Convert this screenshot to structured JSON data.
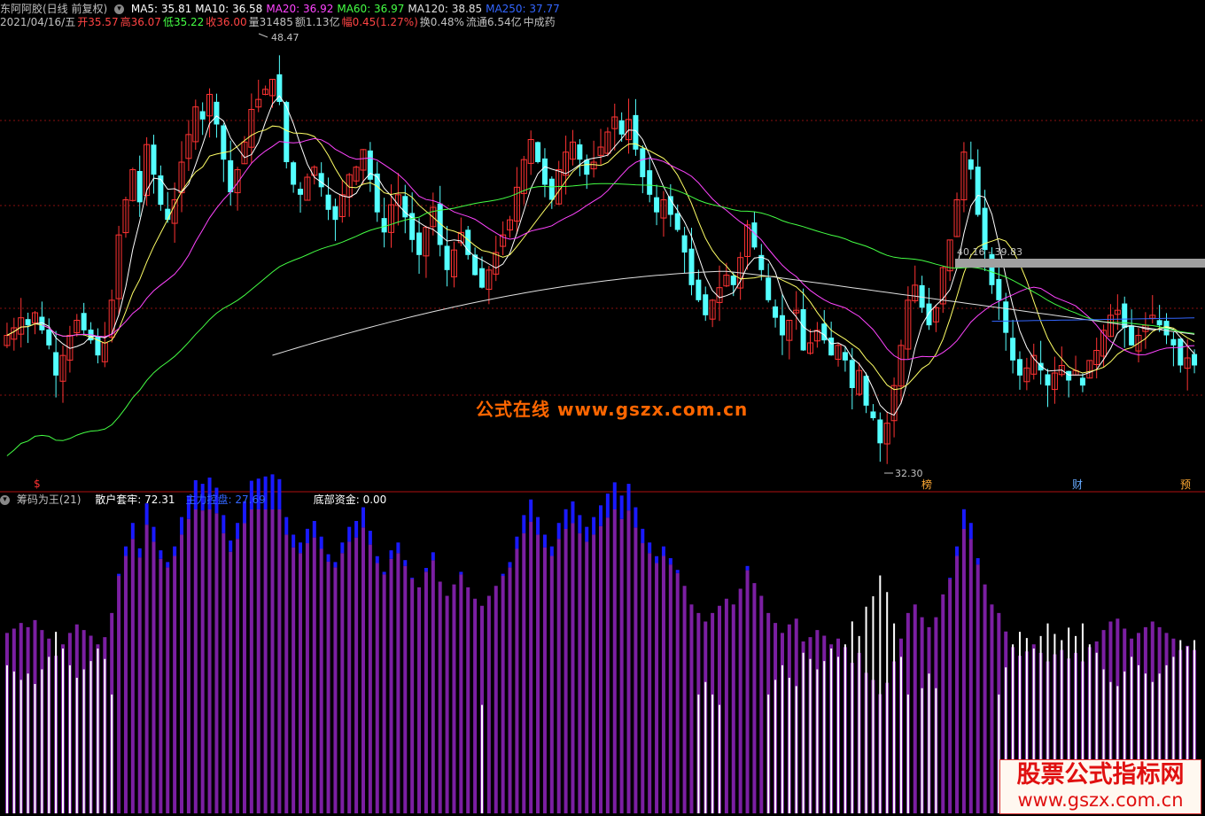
{
  "header": {
    "stock_name": "东阿阿胶(日线 前复权)",
    "ma": [
      {
        "label": "MA5: 35.81",
        "color": "#ffffff"
      },
      {
        "label": "MA10: 36.58",
        "color": "#ffffff"
      },
      {
        "label": "MA20: 36.92",
        "color": "#ff44ff"
      },
      {
        "label": "MA60: 36.97",
        "color": "#44ff44"
      },
      {
        "label": "MA120: 38.85",
        "color": "#e0e0e0"
      },
      {
        "label": "MA250: 37.77",
        "color": "#3366ff"
      }
    ],
    "info": [
      {
        "label": "2021/04/16/五",
        "color": "#c0c0c0"
      },
      {
        "label": "开35.57",
        "color": "#ff4444"
      },
      {
        "label": "高36.07",
        "color": "#ff4444"
      },
      {
        "label": "低35.22",
        "color": "#44ff44"
      },
      {
        "label": "收36.00",
        "color": "#ff4444"
      },
      {
        "label": "量31485",
        "color": "#c0c0c0"
      },
      {
        "label": "额1.13亿",
        "color": "#c0c0c0"
      },
      {
        "label": "幅0.45(1.27%)",
        "color": "#ff4444"
      },
      {
        "label": "换0.48%",
        "color": "#c0c0c0"
      },
      {
        "label": "流通6.54亿",
        "color": "#c0c0c0"
      },
      {
        "label": "中成药",
        "color": "#c0c0c0"
      }
    ]
  },
  "indicator": {
    "name": "筹码为王(21)",
    "items": [
      {
        "label": "散户套牢: 72.31",
        "color": "#ffffff"
      },
      {
        "label": "主力控盘: 27.69",
        "color": "#3366ff"
      },
      {
        "label": "底部资金: 0.00",
        "color": "#ffffff"
      }
    ]
  },
  "price_labels": {
    "high": "48.47",
    "low": "32.30",
    "range": "40.16 - 39.83"
  },
  "markers": [
    {
      "text": "$",
      "color": "#ff3333"
    },
    {
      "text": "榜",
      "color": "#ffaa33"
    },
    {
      "text": "财",
      "color": "#66aaff"
    },
    {
      "text": "预",
      "color": "#ffaa33"
    }
  ],
  "watermark": {
    "center": "公式在线  www.gszx.com.cn",
    "corner_title": "股票公式指标网",
    "corner_url": "www.gszx.com.cn"
  },
  "colors": {
    "up": "#ff3333",
    "down": "#54ffff",
    "ma5": "#ffffff",
    "ma10": "#ffff66",
    "ma20": "#ff44ff",
    "ma60": "#44ff44",
    "ma120": "#e0e0e0",
    "ma250": "#3366ff"
  },
  "chart_data": {
    "type": "line",
    "title": "",
    "xlabel": "",
    "ylabel": "",
    "ylim": [
      31.5,
      49.5
    ],
    "close_series": [
      37.2,
      37.5,
      37.9,
      37.6,
      38.1,
      37.4,
      36.8,
      35.6,
      36.4,
      37.2,
      37.8,
      37.4,
      37.0,
      36.4,
      36.9,
      38.6,
      41.2,
      42.6,
      43.8,
      42.5,
      44.8,
      43.6,
      42.4,
      41.8,
      42.6,
      44.1,
      45.2,
      46.3,
      45.8,
      46.8,
      45.6,
      44.2,
      42.9,
      43.8,
      44.9,
      46.2,
      46.6,
      47.0,
      47.4,
      46.5,
      44.1,
      43.2,
      42.8,
      43.5,
      43.9,
      43.1,
      42.2,
      41.8,
      42.8,
      43.6,
      43.9,
      44.6,
      43.4,
      42.1,
      41.3,
      42.4,
      42.8,
      41.9,
      41.0,
      40.4,
      41.5,
      42.3,
      40.8,
      39.8,
      40.6,
      41.3,
      40.4,
      39.6,
      39.1,
      39.8,
      40.5,
      41.2,
      41.8,
      43.1,
      44.2,
      45.0,
      44.1,
      43.2,
      42.6,
      43.8,
      44.5,
      44.9,
      44.2,
      43.6,
      44.1,
      44.7,
      45.3,
      45.9,
      45.2,
      45.8,
      44.6,
      43.5,
      42.8,
      42.1,
      42.6,
      42.0,
      41.4,
      40.5,
      39.2,
      38.6,
      38.0,
      38.6,
      39.1,
      39.6,
      39.2,
      40.3,
      41.6,
      40.7,
      39.8,
      38.6,
      37.9,
      37.2,
      37.8,
      38.2,
      36.6,
      36.9,
      37.4,
      37.0,
      36.4,
      36.8,
      36.2,
      35.1,
      35.8,
      34.4,
      33.9,
      32.9,
      33.7,
      35.2,
      36.8,
      38.6,
      39.2,
      38.3,
      37.6,
      38.3,
      39.9,
      41.0,
      42.6,
      44.5,
      43.8,
      42.0,
      40.6,
      39.2,
      38.6,
      37.3,
      36.2,
      35.6,
      35.9,
      36.4,
      35.8,
      35.2,
      35.7,
      36.0,
      35.4,
      35.8,
      35.2,
      36.2,
      36.6,
      37.4,
      38.0,
      38.2,
      37.5,
      36.8,
      37.2,
      37.6,
      38.0,
      37.6,
      37.2,
      36.8,
      36.0,
      36.3,
      36.0
    ],
    "ma5_last": 35.81,
    "ma10_last": 36.58,
    "ma20_last": 36.92,
    "ma60_last": 36.97,
    "ma120_last": 38.85,
    "ma250_last": 37.77,
    "high": 48.47,
    "low": 32.3
  }
}
